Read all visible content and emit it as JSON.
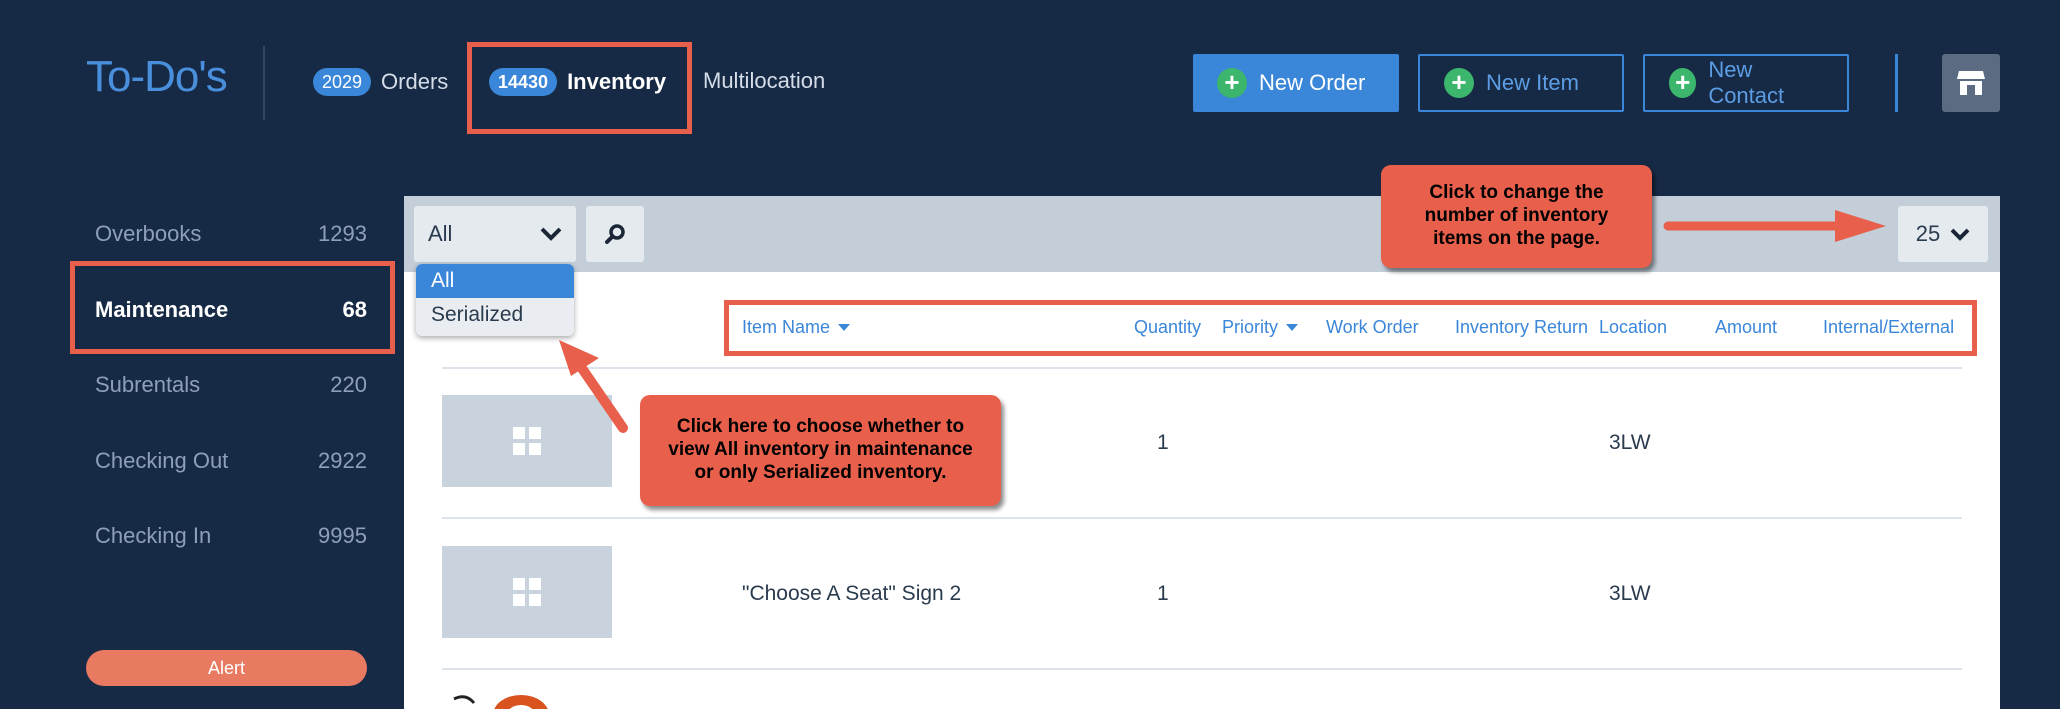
{
  "header": {
    "title": "To-Do's",
    "tabs": [
      {
        "badge": "2029",
        "label": "Orders"
      },
      {
        "badge": "14430",
        "label": "Inventory"
      },
      {
        "label": "Multilocation"
      }
    ],
    "buttons": {
      "new_order": "New Order",
      "new_item": "New Item",
      "new_contact": "New Contact"
    }
  },
  "sidebar": {
    "items": [
      {
        "label": "Overbooks",
        "count": "1293"
      },
      {
        "label": "Maintenance",
        "count": "68"
      },
      {
        "label": "Subrentals",
        "count": "220"
      },
      {
        "label": "Checking Out",
        "count": "2922"
      },
      {
        "label": "Checking In",
        "count": "9995"
      }
    ],
    "alert": "Alert"
  },
  "toolbar": {
    "filter_value": "All",
    "filter_options": [
      "All",
      "Serialized"
    ],
    "page_size": "25"
  },
  "table": {
    "columns": [
      "Item Name",
      "Quantity",
      "Priority",
      "Work Order",
      "Inventory Return",
      "Location",
      "Amount",
      "Internal/External"
    ],
    "rows": [
      {
        "name": "",
        "quantity": "1",
        "location": "3LW"
      },
      {
        "name": "\"Choose A Seat\" Sign 2",
        "quantity": "1",
        "location": "3LW"
      }
    ]
  },
  "callouts": {
    "page_size": "Click to change the number of inventory items on the page.",
    "filter": "Click here to choose whether to view All inventory in maintenance or only Serialized inventory."
  },
  "colors": {
    "background": "#172a45",
    "accent": "#3a86d8",
    "annotation": "#e8604c",
    "add_green": "#3cb66c"
  }
}
